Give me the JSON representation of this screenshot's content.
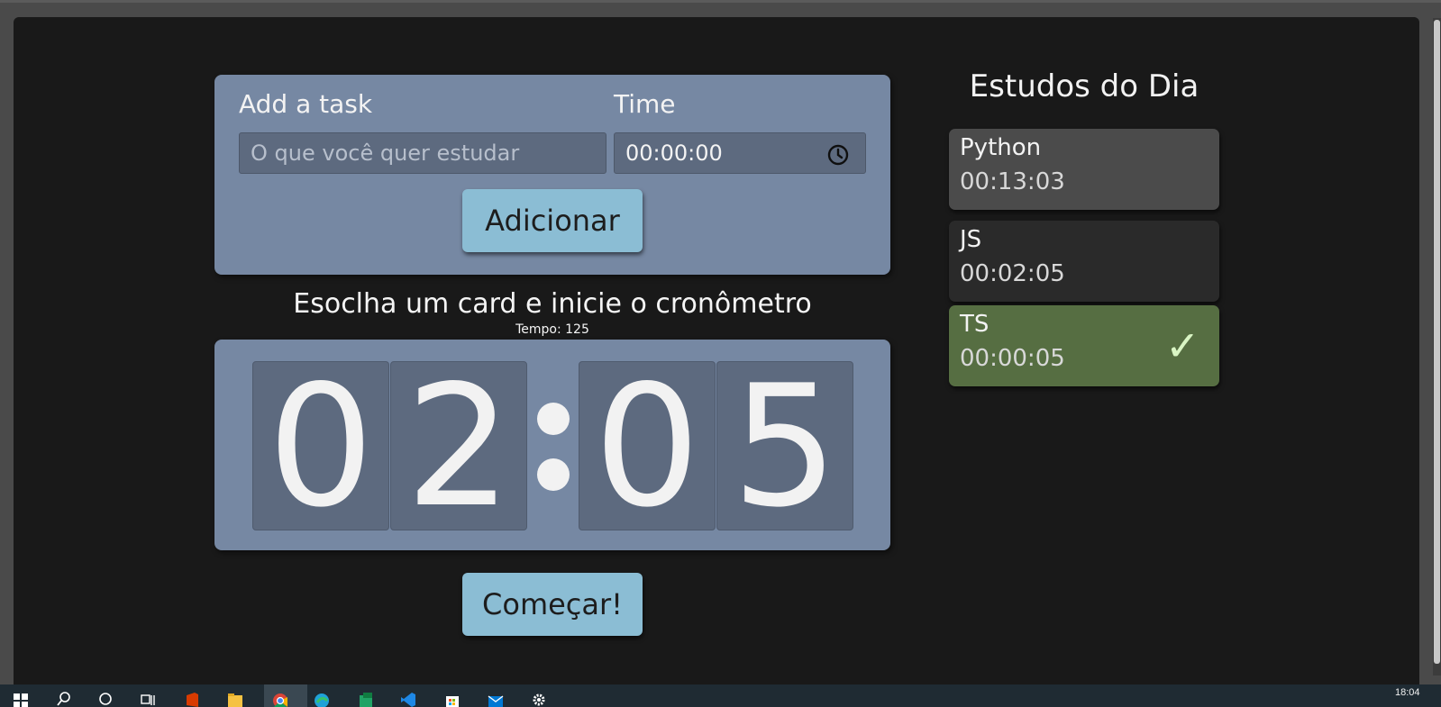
{
  "form": {
    "task_label": "Add a task",
    "task_placeholder": "O que você quer estudar",
    "time_label": "Time",
    "time_value": "00:00:00",
    "add_button": "Adicionar"
  },
  "timer": {
    "heading": "Esoclha um card e inicie o cronômetro",
    "tempo_text": "Tempo: 125",
    "digits": [
      "0",
      "2",
      "0",
      "5"
    ],
    "start_button": "Começar!"
  },
  "sidebar": {
    "title": "Estudos do Dia",
    "cards": [
      {
        "name": "Python",
        "time": "00:13:03",
        "selected": false,
        "completed": false
      },
      {
        "name": "JS",
        "time": "00:02:05",
        "selected": true,
        "completed": false
      },
      {
        "name": "TS",
        "time": "00:00:05",
        "selected": false,
        "completed": true,
        "check_icon": "✓"
      }
    ]
  },
  "colors": {
    "panel": "#7688a3",
    "button": "#8bbdd4",
    "card_default": "#4b4b4b",
    "card_selected": "#2a2a2a",
    "card_completed": "#566e42"
  },
  "taskbar": {
    "clock": "18:04",
    "icons": [
      "windows-start-icon",
      "search-icon",
      "cortana-icon",
      "task-view-icon",
      "office-icon",
      "file-explorer-icon",
      "chrome-icon",
      "edge-icon",
      "green-app-icon",
      "vscode-icon",
      "store-icon",
      "mail-icon",
      "settings-gear-icon"
    ]
  }
}
